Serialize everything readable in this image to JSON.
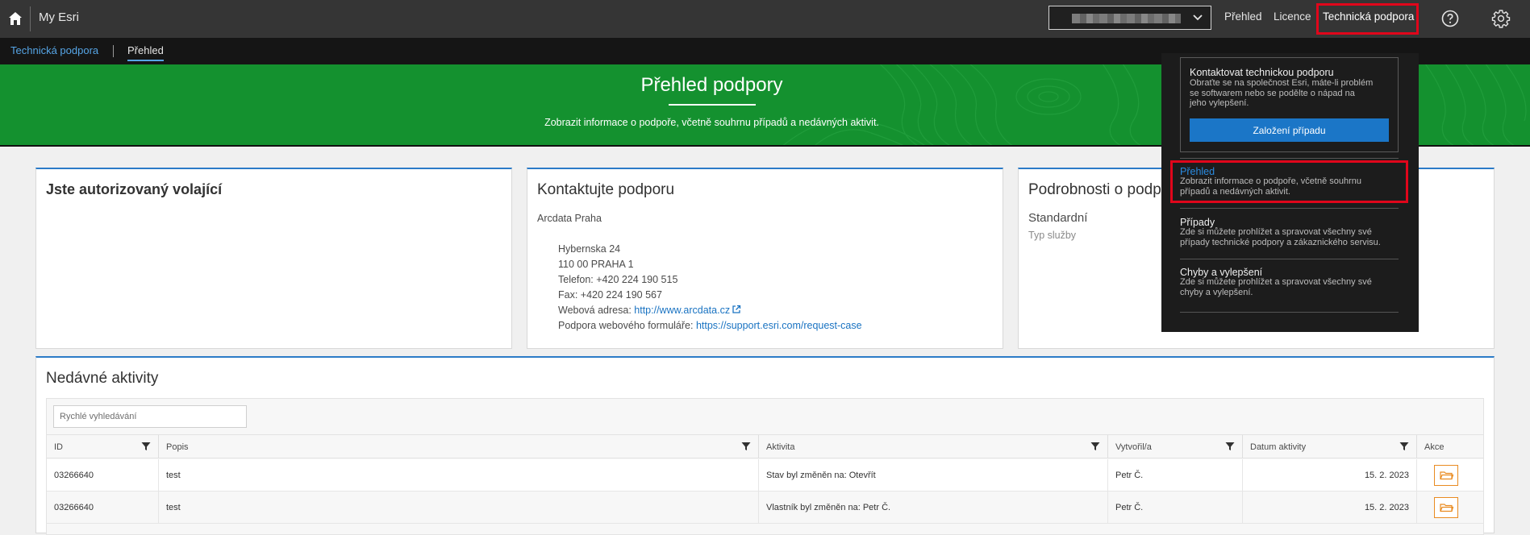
{
  "topbar": {
    "app_title": "My Esri",
    "org_selector_value": "",
    "nav": [
      "Přehled",
      "Licence",
      "Technická podpora"
    ]
  },
  "breadcrumb": {
    "parent": "Technická podpora",
    "current": "Přehled"
  },
  "banner": {
    "title": "Přehled podpory",
    "subtitle": "Zobrazit informace o podpoře, včetně souhrnu případů a nedávných aktivit."
  },
  "cards": {
    "authorized": {
      "title": "Jste autorizovaný volající"
    },
    "contact": {
      "title": "Kontaktujte podporu",
      "org": "Arcdata Praha",
      "street": "Hybernska 24",
      "city": "110 00 PRAHA 1",
      "phone": "Telefon: +420 224 190 515",
      "fax": "Fax: +420 224 190 567",
      "web_label": "Webová adresa: ",
      "web_url": "http://www.arcdata.cz",
      "form_label": "Podpora webového formuláře: ",
      "form_url": "https://support.esri.com/request-case"
    },
    "details": {
      "title": "Podrobnosti o podp",
      "plan": "Standardní",
      "plan_label": "Typ služby"
    }
  },
  "activity": {
    "title": "Nedávné aktivity",
    "search_placeholder": "Rychlé vyhledávání",
    "columns": [
      "ID",
      "Popis",
      "Aktivita",
      "Vytvořil/a",
      "Datum aktivity",
      "Akce"
    ],
    "rows": [
      {
        "id": "03266640",
        "desc": "test",
        "activity": "Stav byl změněn na: Otevřít",
        "by": "Petr Č.",
        "date": "15. 2. 2023"
      },
      {
        "id": "03266640",
        "desc": "test",
        "activity": "Vlastník byl změněn na: Petr Č.",
        "by": "Petr Č.",
        "date": "15. 2. 2023"
      }
    ]
  },
  "dropdown": {
    "contact_title": "Kontaktovat technickou podporu",
    "contact_text": [
      "Obraťte se na společnost Esri, máte-li problém",
      "se softwarem nebo se podělte o nápad na",
      "jeho vylepšení."
    ],
    "create_case": "Založení případu",
    "items": [
      {
        "title": "Přehled",
        "text": [
          "Zobrazit informace o podpoře, včetně souhrnu",
          "případů a nedávných aktivit."
        ]
      },
      {
        "title": "Případy",
        "text": [
          "Zde si můžete prohlížet a spravovat všechny své",
          "případy technické podpory a zákaznického servisu."
        ]
      },
      {
        "title": "Chyby a vylepšení",
        "text": [
          "Zde si můžete prohlížet a spravovat všechny své",
          "chyby a vylepšení."
        ]
      }
    ]
  },
  "colors": {
    "accent": "#2b7bc7",
    "banner": "#14912f",
    "highlight": "#e0061b",
    "action": "#e98b21"
  }
}
